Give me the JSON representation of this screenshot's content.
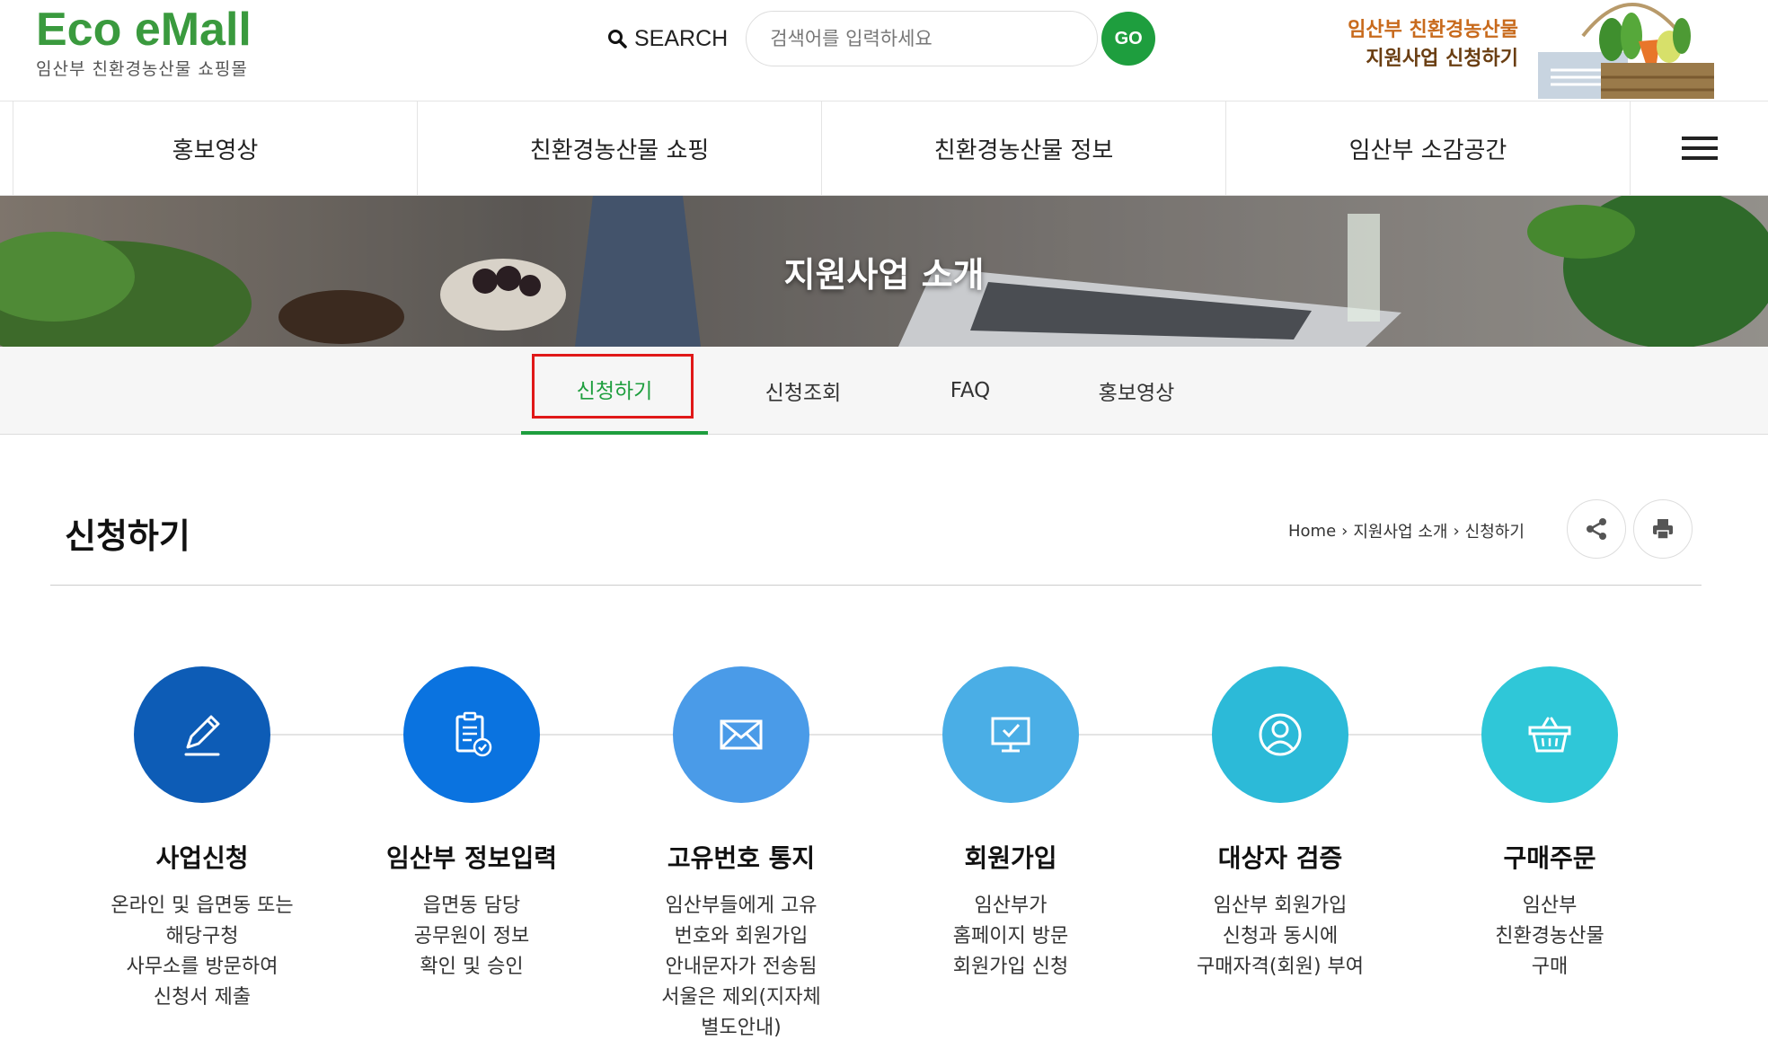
{
  "header": {
    "logo_title": "Eco eMall",
    "logo_subtitle": "임산부 친환경농산물 쇼핑몰",
    "search_label": "SEARCH",
    "search_placeholder": "검색어를 입력하세요",
    "go_label": "GO",
    "promo_line1": "임산부 친환경농산물",
    "promo_line2": "지원사업 신청하기"
  },
  "nav": {
    "items": [
      {
        "label": "홍보영상"
      },
      {
        "label": "친환경농산물 쇼핑"
      },
      {
        "label": "친환경농산물 정보"
      },
      {
        "label": "임산부 소감공간"
      }
    ]
  },
  "banner": {
    "title": "지원사업 소개"
  },
  "subtabs": [
    {
      "label": "신청하기",
      "active": true
    },
    {
      "label": "신청조회",
      "active": false
    },
    {
      "label": "FAQ",
      "active": false
    },
    {
      "label": "홍보영상",
      "active": false
    }
  ],
  "page": {
    "title": "신청하기",
    "breadcrumb": [
      "Home",
      "지원사업 소개",
      "신청하기"
    ]
  },
  "steps": [
    {
      "title": "사업신청",
      "desc": "온라인 및 읍면동 또는\n해당구청\n사무소를 방문하여\n신청서 제출",
      "color": "#0d5cb6",
      "icon": "pen-icon"
    },
    {
      "title": "임산부 정보입력",
      "desc": "읍면동 담당\n공무원이 정보\n확인 및 승인",
      "color": "#0a73e0",
      "icon": "document-check-icon"
    },
    {
      "title": "고유번호 통지",
      "desc": "임산부들에게 고유\n번호와 회원가입\n안내문자가 전송됨\n서울은 제외(지자체\n별도안내)",
      "color": "#4a9be8",
      "icon": "envelope-icon"
    },
    {
      "title": "회원가입",
      "desc": "임산부가\n홈페이지 방문\n회원가입 신청",
      "color": "#4aaee6",
      "icon": "monitor-check-icon"
    },
    {
      "title": "대상자 검증",
      "desc": "임산부 회원가입\n신청과 동시에\n구매자격(회원) 부여",
      "color": "#2cbad8",
      "icon": "user-circle-icon"
    },
    {
      "title": "구매주문",
      "desc": "임산부\n친환경농산물\n구매",
      "color": "#2fc7d8",
      "icon": "basket-icon"
    }
  ],
  "colors": {
    "brand_green": "#3a9a3e",
    "go_green": "#1e9e3e",
    "promo_orange": "#c86a1c",
    "highlight_red": "#e01818"
  }
}
